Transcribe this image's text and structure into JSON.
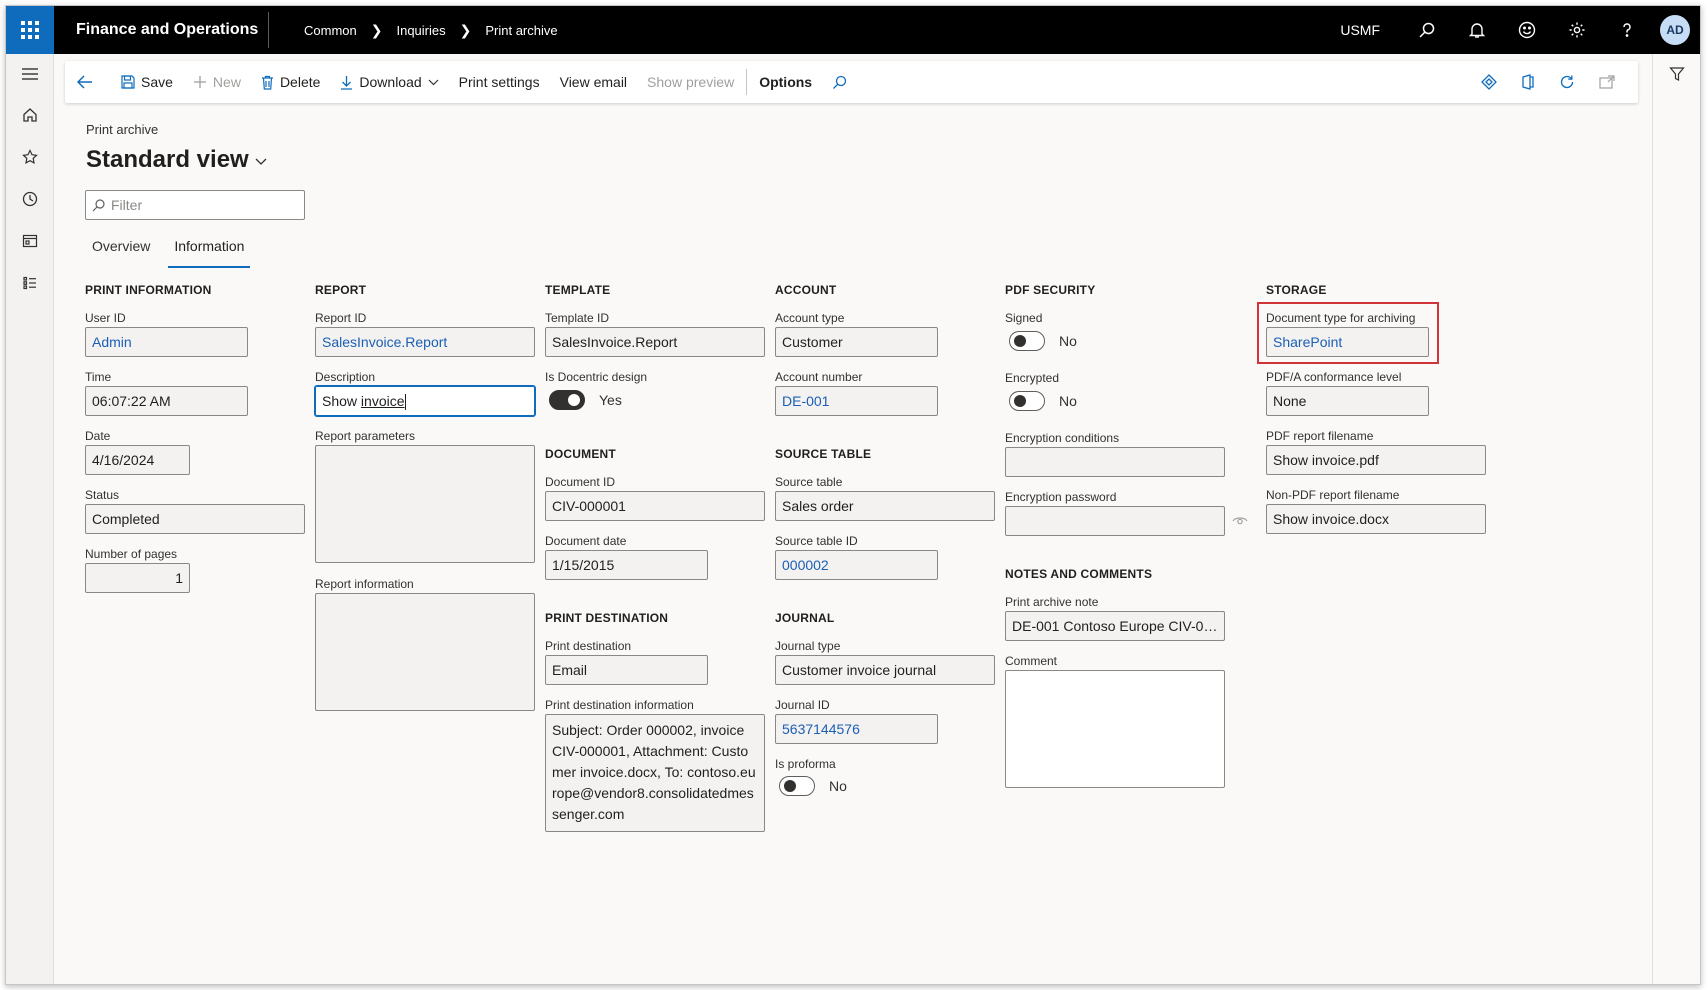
{
  "app": {
    "title": "Finance and Operations",
    "company": "USMF",
    "user_initials": "AD"
  },
  "breadcrumb": [
    "Common",
    "Inquiries",
    "Print archive"
  ],
  "toolbar": {
    "save": "Save",
    "new": "New",
    "delete": "Delete",
    "download": "Download",
    "print_settings": "Print settings",
    "view_email": "View email",
    "show_preview": "Show preview",
    "options": "Options"
  },
  "page": {
    "caption": "Print archive",
    "view_title": "Standard view",
    "filter_placeholder": "Filter",
    "tabs": [
      "Overview",
      "Information"
    ],
    "active_tab": "Information"
  },
  "print_information": {
    "heading": "PRINT INFORMATION",
    "user_id_label": "User ID",
    "user_id": "Admin",
    "time_label": "Time",
    "time": "06:07:22 AM",
    "date_label": "Date",
    "date": "4/16/2024",
    "status_label": "Status",
    "status": "Completed",
    "pages_label": "Number of pages",
    "pages": "1"
  },
  "report": {
    "heading": "REPORT",
    "report_id_label": "Report ID",
    "report_id": "SalesInvoice.Report",
    "description_label": "Description",
    "description_prefix": "Show ",
    "description_underlined": "invoice",
    "parameters_label": "Report parameters",
    "parameters": "",
    "information_label": "Report information",
    "information": ""
  },
  "template": {
    "heading": "TEMPLATE",
    "template_id_label": "Template ID",
    "template_id": "SalesInvoice.Report",
    "docentric_label": "Is Docentric design",
    "docentric": "Yes"
  },
  "document": {
    "heading": "DOCUMENT",
    "document_id_label": "Document ID",
    "document_id": "CIV-000001",
    "document_date_label": "Document date",
    "document_date": "1/15/2015"
  },
  "print_destination": {
    "heading": "PRINT DESTINATION",
    "destination_label": "Print destination",
    "destination": "Email",
    "info_label": "Print destination information",
    "info": "Subject: Order 000002, invoice CIV-000001, Attachment: Customer invoice.docx, To: contoso.europe@vendor8.consolidatedmessenger.com"
  },
  "account": {
    "heading": "ACCOUNT",
    "type_label": "Account type",
    "type": "Customer",
    "number_label": "Account number",
    "number": "DE-001"
  },
  "source_table": {
    "heading": "SOURCE TABLE",
    "table_label": "Source table",
    "table": "Sales order",
    "id_label": "Source table ID",
    "id": "000002"
  },
  "journal": {
    "heading": "JOURNAL",
    "type_label": "Journal type",
    "type": "Customer invoice journal",
    "id_label": "Journal ID",
    "id": "5637144576",
    "proforma_label": "Is proforma",
    "proforma": "No"
  },
  "pdf_security": {
    "heading": "PDF SECURITY",
    "signed_label": "Signed",
    "signed": "No",
    "encrypted_label": "Encrypted",
    "encrypted": "No",
    "conditions_label": "Encryption conditions",
    "conditions": "",
    "password_label": "Encryption password",
    "password": ""
  },
  "notes": {
    "heading": "NOTES AND COMMENTS",
    "note_label": "Print archive note",
    "note": "DE-001 Contoso Europe CIV-00...",
    "comment_label": "Comment",
    "comment": ""
  },
  "storage": {
    "heading": "STORAGE",
    "doc_type_label": "Document type for archiving",
    "doc_type": "SharePoint",
    "pdfa_label": "PDF/A conformance level",
    "pdfa": "None",
    "pdf_filename_label": "PDF report filename",
    "pdf_filename": "Show invoice.pdf",
    "nonpdf_filename_label": "Non-PDF report filename",
    "nonpdf_filename": "Show invoice.docx"
  },
  "colors": {
    "brand": "#0f6cbd",
    "link": "#1b5fb5",
    "highlight": "#d13438"
  }
}
